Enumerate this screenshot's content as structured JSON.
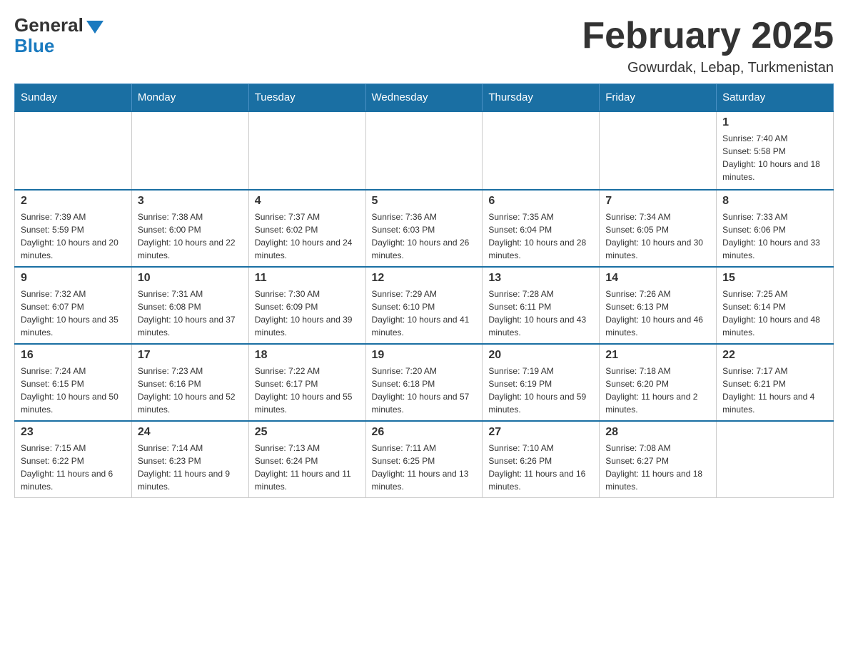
{
  "header": {
    "logo_general": "General",
    "logo_blue": "Blue",
    "month_title": "February 2025",
    "location": "Gowurdak, Lebap, Turkmenistan"
  },
  "weekdays": [
    "Sunday",
    "Monday",
    "Tuesday",
    "Wednesday",
    "Thursday",
    "Friday",
    "Saturday"
  ],
  "weeks": [
    [
      {
        "day": "",
        "sunrise": "",
        "sunset": "",
        "daylight": ""
      },
      {
        "day": "",
        "sunrise": "",
        "sunset": "",
        "daylight": ""
      },
      {
        "day": "",
        "sunrise": "",
        "sunset": "",
        "daylight": ""
      },
      {
        "day": "",
        "sunrise": "",
        "sunset": "",
        "daylight": ""
      },
      {
        "day": "",
        "sunrise": "",
        "sunset": "",
        "daylight": ""
      },
      {
        "day": "",
        "sunrise": "",
        "sunset": "",
        "daylight": ""
      },
      {
        "day": "1",
        "sunrise": "Sunrise: 7:40 AM",
        "sunset": "Sunset: 5:58 PM",
        "daylight": "Daylight: 10 hours and 18 minutes."
      }
    ],
    [
      {
        "day": "2",
        "sunrise": "Sunrise: 7:39 AM",
        "sunset": "Sunset: 5:59 PM",
        "daylight": "Daylight: 10 hours and 20 minutes."
      },
      {
        "day": "3",
        "sunrise": "Sunrise: 7:38 AM",
        "sunset": "Sunset: 6:00 PM",
        "daylight": "Daylight: 10 hours and 22 minutes."
      },
      {
        "day": "4",
        "sunrise": "Sunrise: 7:37 AM",
        "sunset": "Sunset: 6:02 PM",
        "daylight": "Daylight: 10 hours and 24 minutes."
      },
      {
        "day": "5",
        "sunrise": "Sunrise: 7:36 AM",
        "sunset": "Sunset: 6:03 PM",
        "daylight": "Daylight: 10 hours and 26 minutes."
      },
      {
        "day": "6",
        "sunrise": "Sunrise: 7:35 AM",
        "sunset": "Sunset: 6:04 PM",
        "daylight": "Daylight: 10 hours and 28 minutes."
      },
      {
        "day": "7",
        "sunrise": "Sunrise: 7:34 AM",
        "sunset": "Sunset: 6:05 PM",
        "daylight": "Daylight: 10 hours and 30 minutes."
      },
      {
        "day": "8",
        "sunrise": "Sunrise: 7:33 AM",
        "sunset": "Sunset: 6:06 PM",
        "daylight": "Daylight: 10 hours and 33 minutes."
      }
    ],
    [
      {
        "day": "9",
        "sunrise": "Sunrise: 7:32 AM",
        "sunset": "Sunset: 6:07 PM",
        "daylight": "Daylight: 10 hours and 35 minutes."
      },
      {
        "day": "10",
        "sunrise": "Sunrise: 7:31 AM",
        "sunset": "Sunset: 6:08 PM",
        "daylight": "Daylight: 10 hours and 37 minutes."
      },
      {
        "day": "11",
        "sunrise": "Sunrise: 7:30 AM",
        "sunset": "Sunset: 6:09 PM",
        "daylight": "Daylight: 10 hours and 39 minutes."
      },
      {
        "day": "12",
        "sunrise": "Sunrise: 7:29 AM",
        "sunset": "Sunset: 6:10 PM",
        "daylight": "Daylight: 10 hours and 41 minutes."
      },
      {
        "day": "13",
        "sunrise": "Sunrise: 7:28 AM",
        "sunset": "Sunset: 6:11 PM",
        "daylight": "Daylight: 10 hours and 43 minutes."
      },
      {
        "day": "14",
        "sunrise": "Sunrise: 7:26 AM",
        "sunset": "Sunset: 6:13 PM",
        "daylight": "Daylight: 10 hours and 46 minutes."
      },
      {
        "day": "15",
        "sunrise": "Sunrise: 7:25 AM",
        "sunset": "Sunset: 6:14 PM",
        "daylight": "Daylight: 10 hours and 48 minutes."
      }
    ],
    [
      {
        "day": "16",
        "sunrise": "Sunrise: 7:24 AM",
        "sunset": "Sunset: 6:15 PM",
        "daylight": "Daylight: 10 hours and 50 minutes."
      },
      {
        "day": "17",
        "sunrise": "Sunrise: 7:23 AM",
        "sunset": "Sunset: 6:16 PM",
        "daylight": "Daylight: 10 hours and 52 minutes."
      },
      {
        "day": "18",
        "sunrise": "Sunrise: 7:22 AM",
        "sunset": "Sunset: 6:17 PM",
        "daylight": "Daylight: 10 hours and 55 minutes."
      },
      {
        "day": "19",
        "sunrise": "Sunrise: 7:20 AM",
        "sunset": "Sunset: 6:18 PM",
        "daylight": "Daylight: 10 hours and 57 minutes."
      },
      {
        "day": "20",
        "sunrise": "Sunrise: 7:19 AM",
        "sunset": "Sunset: 6:19 PM",
        "daylight": "Daylight: 10 hours and 59 minutes."
      },
      {
        "day": "21",
        "sunrise": "Sunrise: 7:18 AM",
        "sunset": "Sunset: 6:20 PM",
        "daylight": "Daylight: 11 hours and 2 minutes."
      },
      {
        "day": "22",
        "sunrise": "Sunrise: 7:17 AM",
        "sunset": "Sunset: 6:21 PM",
        "daylight": "Daylight: 11 hours and 4 minutes."
      }
    ],
    [
      {
        "day": "23",
        "sunrise": "Sunrise: 7:15 AM",
        "sunset": "Sunset: 6:22 PM",
        "daylight": "Daylight: 11 hours and 6 minutes."
      },
      {
        "day": "24",
        "sunrise": "Sunrise: 7:14 AM",
        "sunset": "Sunset: 6:23 PM",
        "daylight": "Daylight: 11 hours and 9 minutes."
      },
      {
        "day": "25",
        "sunrise": "Sunrise: 7:13 AM",
        "sunset": "Sunset: 6:24 PM",
        "daylight": "Daylight: 11 hours and 11 minutes."
      },
      {
        "day": "26",
        "sunrise": "Sunrise: 7:11 AM",
        "sunset": "Sunset: 6:25 PM",
        "daylight": "Daylight: 11 hours and 13 minutes."
      },
      {
        "day": "27",
        "sunrise": "Sunrise: 7:10 AM",
        "sunset": "Sunset: 6:26 PM",
        "daylight": "Daylight: 11 hours and 16 minutes."
      },
      {
        "day": "28",
        "sunrise": "Sunrise: 7:08 AM",
        "sunset": "Sunset: 6:27 PM",
        "daylight": "Daylight: 11 hours and 18 minutes."
      },
      {
        "day": "",
        "sunrise": "",
        "sunset": "",
        "daylight": ""
      }
    ]
  ]
}
